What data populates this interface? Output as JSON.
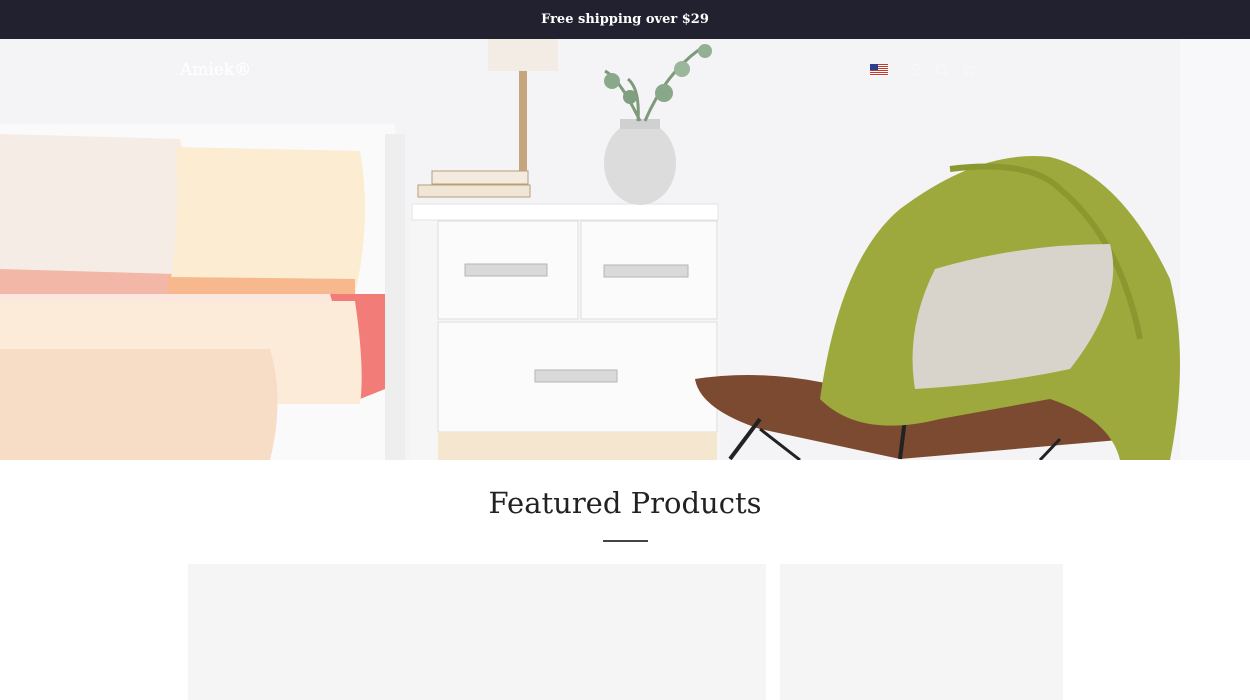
{
  "announcement": {
    "text": "Free shipping over $29"
  },
  "header": {
    "logo": "Amiek®",
    "region_flag_icon": "us-flag-icon",
    "currency": "",
    "icons": [
      "user-icon",
      "search-icon",
      "cart-icon"
    ]
  },
  "hero": {
    "image_icon": "bedroom-scene"
  },
  "featured": {
    "title": "Featured Products"
  },
  "colors": {
    "announcement_bg": "#22212f",
    "announcement_text": "#ffffff",
    "card_bg": "#f5f5f5",
    "divider": "#444444"
  }
}
